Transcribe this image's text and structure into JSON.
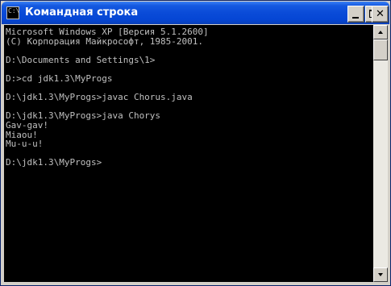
{
  "window": {
    "title": "Командная строка",
    "icon": "console-icon",
    "icon_glyph": "C:\\"
  },
  "controls": {
    "minimize": "minimize-icon",
    "maximize": "maximize-icon",
    "close": "close-icon",
    "close_glyph": "✕"
  },
  "console": {
    "lines": [
      "Microsoft Windows XP [Версия 5.1.2600]",
      "(С) Корпорация Майкрософт, 1985-2001.",
      "",
      "D:\\Documents and Settings\\1>",
      "",
      "D:>cd jdk1.3\\MyProgs",
      "",
      "D:\\jdk1.3\\MyProgs>javac Chorus.java",
      "",
      "D:\\jdk1.3\\MyProgs>java Chorys",
      "Gav-gav!",
      "Miaou!",
      "Mu-u-u!",
      "",
      "D:\\jdk1.3\\MyProgs>"
    ]
  },
  "scrollbar": {
    "up_icon": "scroll-up-arrow-icon",
    "down_icon": "scroll-down-arrow-icon"
  },
  "colors": {
    "console_bg": "#000000",
    "console_text": "#c0c0c0",
    "titlebar": "#0a4bd8"
  }
}
